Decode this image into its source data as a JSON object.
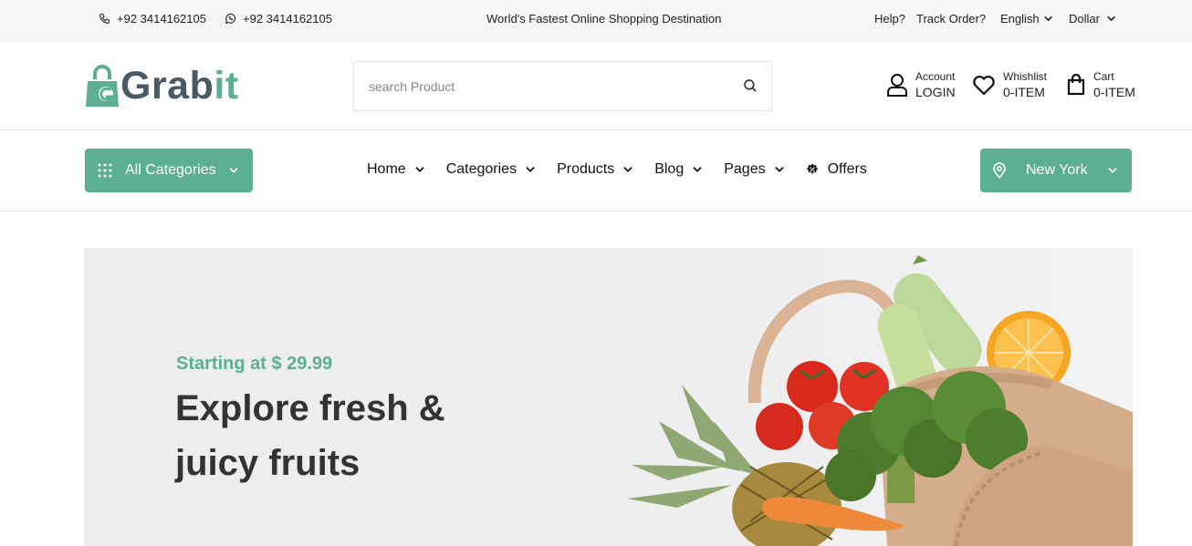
{
  "topbar": {
    "phone": "+92 3414162105",
    "whatsapp": "+92 3414162105",
    "tagline": "World's Fastest Online Shopping Destination",
    "help": "Help?",
    "track": "Track Order?",
    "language": "English",
    "currency": "Dollar"
  },
  "header": {
    "logo_part1": "Grab",
    "logo_part2": "it",
    "search_placeholder": "search Product",
    "account_label": "Account",
    "account_value": "LOGIN",
    "wishlist_label": "Whishlist",
    "wishlist_value": "0-ITEM",
    "cart_label": "Cart",
    "cart_value": "0-ITEM"
  },
  "nav": {
    "all_categories": "All Categories",
    "items": [
      "Home",
      "Categories",
      "Products",
      "Blog",
      "Pages"
    ],
    "offers": "Offers",
    "city": "New York"
  },
  "hero": {
    "subtitle": "Starting at $ 29.99",
    "title": "Explore fresh & juicy fruits"
  },
  "colors": {
    "accent": "#5caf90",
    "logo_dark": "#4b5966",
    "topbar_bg": "#f5f5f6"
  }
}
